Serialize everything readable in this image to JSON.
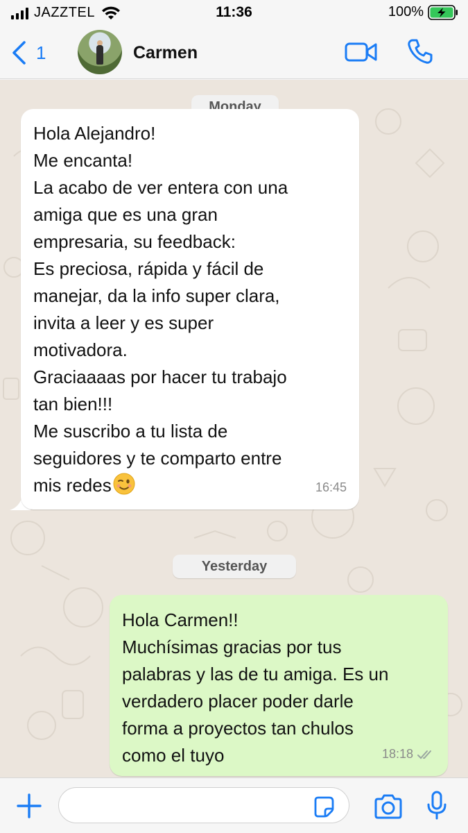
{
  "status_bar": {
    "carrier": "JAZZTEL",
    "time": "11:36",
    "battery": "100%"
  },
  "header": {
    "back_count": "1",
    "contact_name": "Carmen",
    "icons": [
      "back-chevron-icon",
      "video-call-icon",
      "phone-icon"
    ]
  },
  "chat": {
    "messages": [
      {
        "date_label": "Monday",
        "direction": "incoming",
        "text": "Hola Alejandro!\nMe encanta!\nLa acabo de ver entera con una\namiga que es una gran\nempresaria, su feedback:\nEs preciosa, rápida y fácil de\nmanejar, da la info super clara,\ninvita a leer y es super\nmotivadora.\nGraciaaaas por hacer tu trabajo\ntan bien!!!\nMe suscribo a tu lista de\nseguidores y te comparto entre\nmis redes",
        "emoji": "winking-face-emoji",
        "time": "16:45"
      },
      {
        "date_label": "Yesterday",
        "direction": "outgoing",
        "text": "Hola Carmen!!\nMuchísimas gracias por tus\npalabras y las de tu amiga. Es un\nverdadero placer poder darle\nforma a proyectos tan chulos\ncomo el tuyo",
        "time": "18:18",
        "status": "read"
      }
    ]
  },
  "input_bar": {
    "message_value": "",
    "message_placeholder": "",
    "icons": [
      "plus-icon",
      "sticker-icon",
      "camera-icon",
      "microphone-icon"
    ]
  },
  "colors": {
    "accent": "#1a7cf5",
    "outgoing_bubble": "#dcf8c6",
    "incoming_bubble": "#ffffff",
    "wallpaper": "#ece5dd"
  }
}
